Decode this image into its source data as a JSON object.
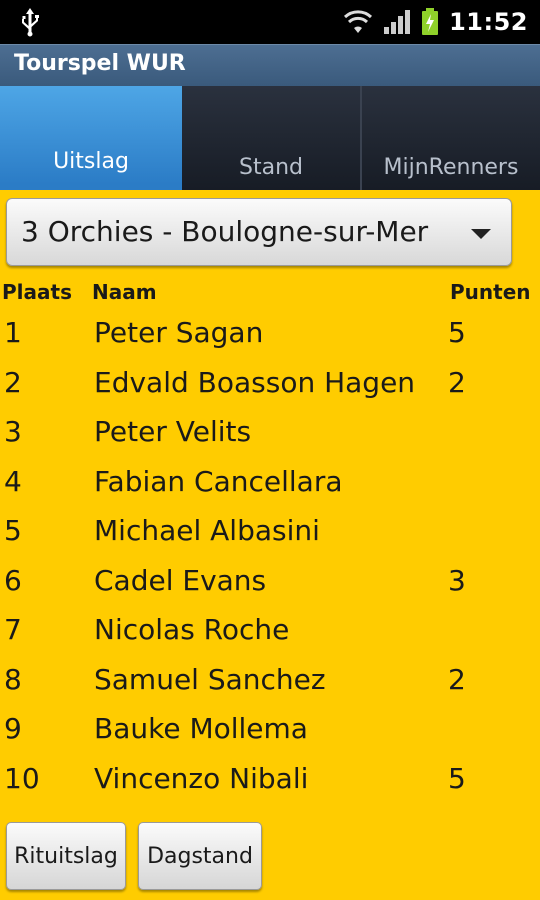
{
  "status_bar": {
    "time": "11:52",
    "icons": [
      "usb-icon",
      "wifi-icon",
      "signal-icon",
      "battery-charging-icon"
    ]
  },
  "app": {
    "title": "Tourspel WUR"
  },
  "tabs": [
    {
      "label": "Uitslag",
      "active": true
    },
    {
      "label": "Stand",
      "active": false
    },
    {
      "label": "MijnRenners",
      "active": false
    }
  ],
  "stage_select": {
    "selected": "3 Orchies - Boulogne-sur-Mer"
  },
  "table": {
    "headers": {
      "plaats": "Plaats",
      "naam": "Naam",
      "punten": "Punten"
    },
    "rows": [
      {
        "plaats": "1",
        "naam": "Peter Sagan",
        "punten": "5"
      },
      {
        "plaats": "2",
        "naam": "Edvald Boasson Hagen",
        "punten": "2"
      },
      {
        "plaats": "3",
        "naam": "Peter Velits",
        "punten": ""
      },
      {
        "plaats": "4",
        "naam": "Fabian Cancellara",
        "punten": ""
      },
      {
        "plaats": "5",
        "naam": "Michael Albasini",
        "punten": ""
      },
      {
        "plaats": "6",
        "naam": "Cadel Evans",
        "punten": "3"
      },
      {
        "plaats": "7",
        "naam": "Nicolas Roche",
        "punten": ""
      },
      {
        "plaats": "8",
        "naam": "Samuel Sanchez",
        "punten": "2"
      },
      {
        "plaats": "9",
        "naam": "Bauke Mollema",
        "punten": ""
      },
      {
        "plaats": "10",
        "naam": "Vincenzo Nibali",
        "punten": "5"
      }
    ]
  },
  "buttons": {
    "rituitslag": "Rituitslag",
    "dagstand": "Dagstand"
  },
  "colors": {
    "background": "#FFCC00",
    "tab_active": "#2B7CC6",
    "titlebar": "#3A5A7C"
  }
}
